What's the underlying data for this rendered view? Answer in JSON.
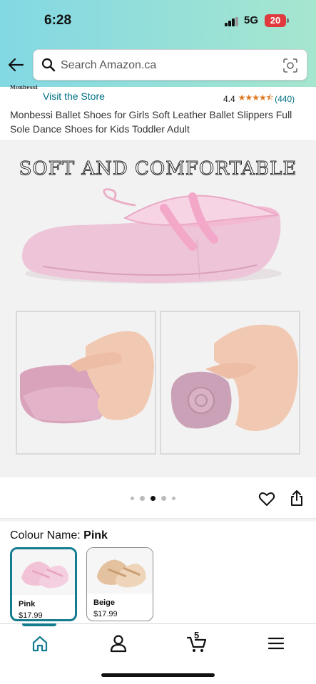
{
  "status_bar": {
    "time": "6:28",
    "network": "5G",
    "battery": "20"
  },
  "header": {
    "search_placeholder": "Search Amazon.ca"
  },
  "store": {
    "brand_logo_text": "Monbessi",
    "visit_label": "Visit the Store",
    "rating_value": "4.4",
    "rating_stars": 4.4,
    "rating_count": "(440)"
  },
  "product": {
    "title": "Monbessi Ballet Shoes for Girls Soft Leather Ballet Slippers Full Sole Dance Shoes for Kids Toddler Adult",
    "image_headline": "SOFT AND COMFORTABLE",
    "carousel": {
      "total": 5,
      "active_index": 2
    }
  },
  "colour": {
    "label": "Colour Name: ",
    "selected": "Pink",
    "options": [
      {
        "name": "Pink",
        "price": "$17.99",
        "color": "#f2c3d6"
      },
      {
        "name": "Beige",
        "price": "$17.99",
        "color": "#e9c9a6"
      }
    ]
  },
  "bottom_nav": {
    "items": [
      "home-icon",
      "account-icon",
      "cart-icon",
      "menu-icon"
    ],
    "cart_count": "5",
    "accent": "#147c8e"
  },
  "colors": {
    "link": "#007185",
    "star": "#de7921",
    "header_from": "#82d8e3",
    "header_to": "#a6e6cf"
  }
}
